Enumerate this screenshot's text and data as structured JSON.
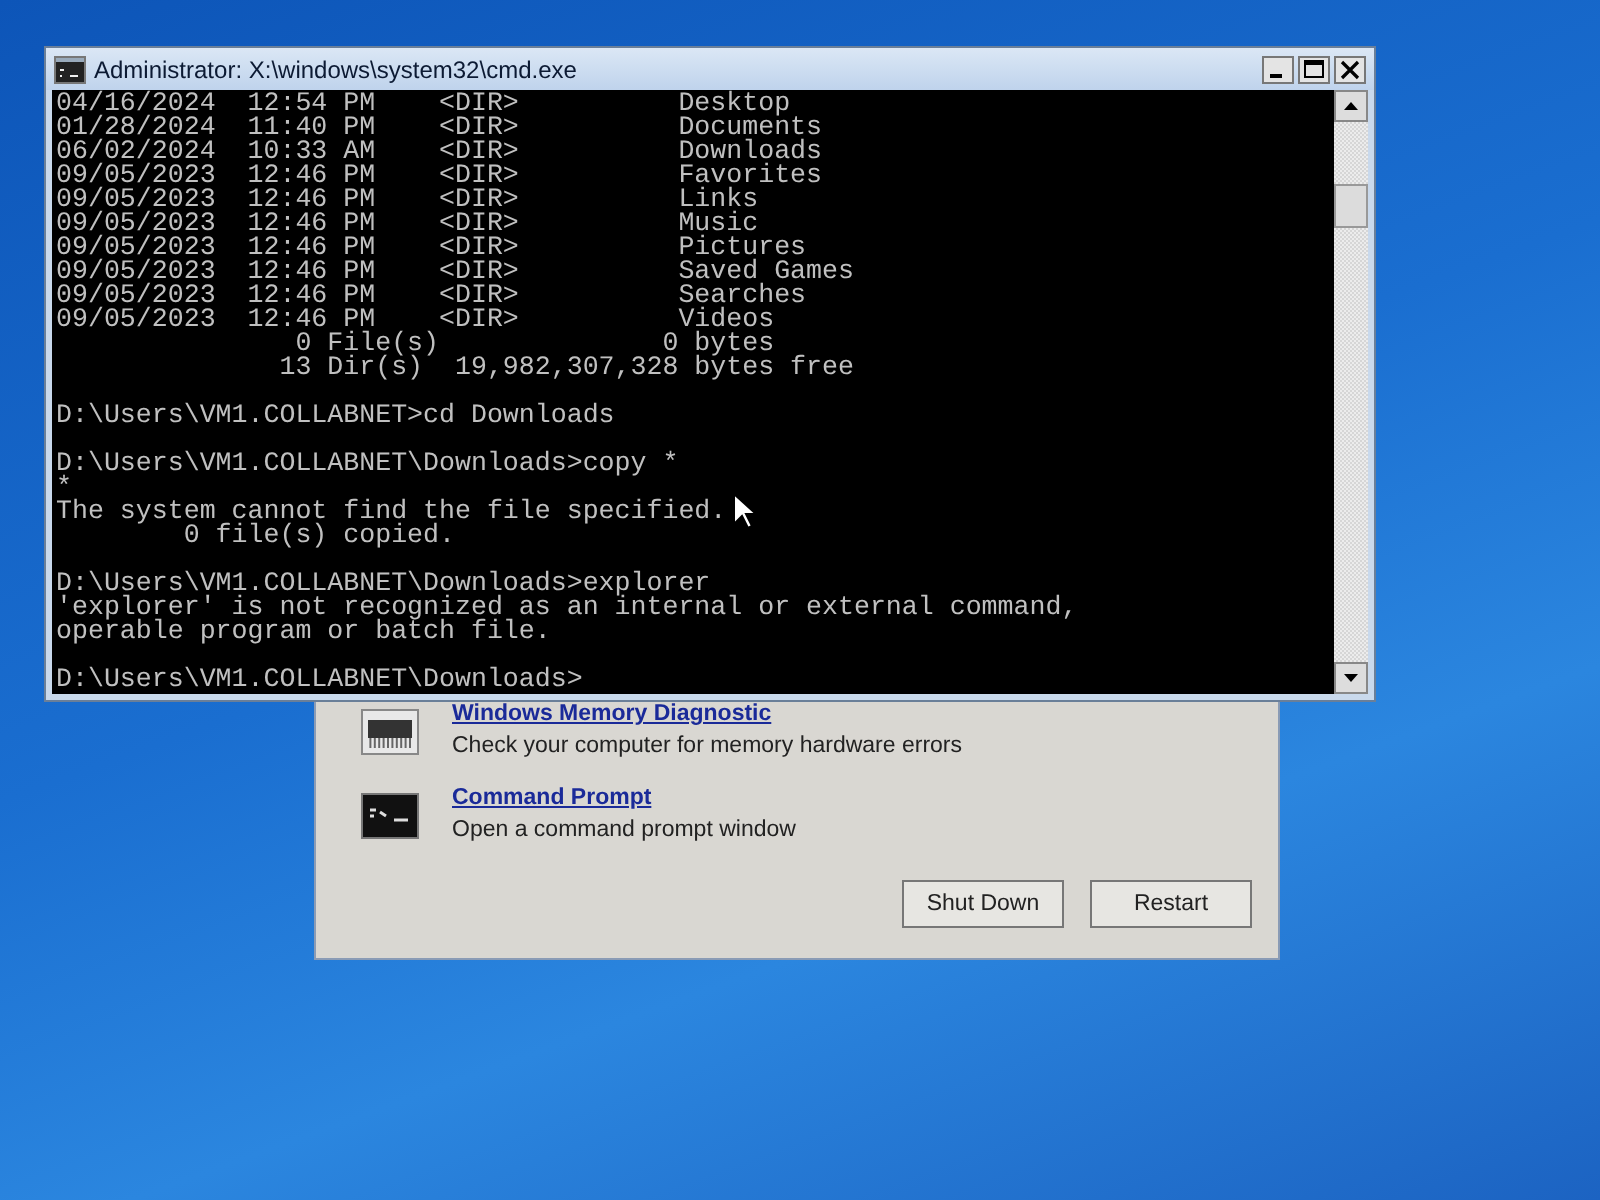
{
  "console_window": {
    "title": "Administrator: X:\\windows\\system32\\cmd.exe",
    "blocks": [
      [
        "04/16/2024  12:54 PM    <DIR>          Desktop",
        "01/28/2024  11:40 PM    <DIR>          Documents",
        "06/02/2024  10:33 AM    <DIR>          Downloads",
        "09/05/2023  12:46 PM    <DIR>          Favorites",
        "09/05/2023  12:46 PM    <DIR>          Links",
        "09/05/2023  12:46 PM    <DIR>          Music",
        "09/05/2023  12:46 PM    <DIR>          Pictures",
        "09/05/2023  12:46 PM    <DIR>          Saved Games",
        "09/05/2023  12:46 PM    <DIR>          Searches",
        "09/05/2023  12:46 PM    <DIR>          Videos",
        "               0 File(s)              0 bytes",
        "              13 Dir(s)  19,982,307,328 bytes free"
      ],
      [
        "D:\\Users\\VM1.COLLABNET>cd Downloads"
      ],
      [
        "D:\\Users\\VM1.COLLABNET\\Downloads>copy *",
        "*",
        "The system cannot find the file specified.",
        "        0 file(s) copied."
      ],
      [
        "D:\\Users\\VM1.COLLABNET\\Downloads>explorer",
        "'explorer' is not recognized as an internal or external command,",
        "operable program or batch file."
      ],
      [
        "D:\\Users\\VM1.COLLABNET\\Downloads>"
      ]
    ]
  },
  "recovery_dialog": {
    "tools": [
      {
        "kind": "memory",
        "name": "Windows Memory Diagnostic",
        "description": "Check your computer for memory hardware errors"
      },
      {
        "kind": "console",
        "name": "Command Prompt",
        "description": "Open a command prompt window"
      }
    ],
    "buttons": [
      "Shut Down",
      "Restart"
    ]
  }
}
